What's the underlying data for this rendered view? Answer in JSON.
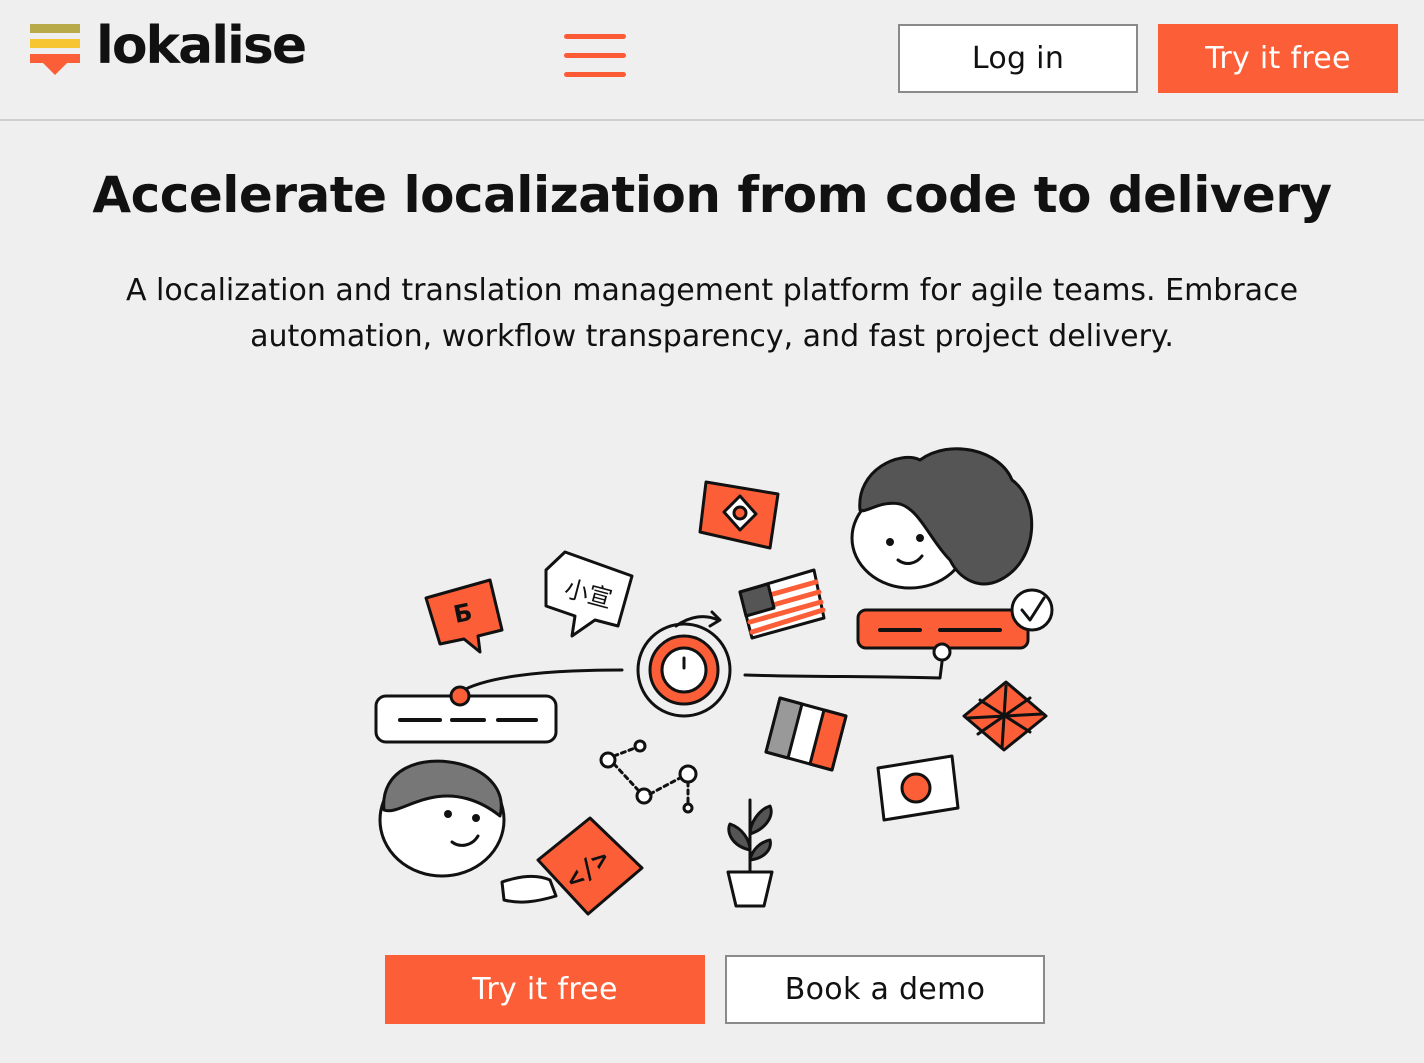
{
  "header": {
    "logo_text": "lokalise",
    "menu_icon": "hamburger-menu-icon",
    "login_label": "Log in",
    "try_free_label": "Try it free"
  },
  "hero": {
    "title": "Accelerate localization from code to delivery",
    "subtitle_line1": "A localization and translation management platform for agile teams. Embrace",
    "subtitle_line2": "automation, workflow transparency, and fast project delivery."
  },
  "illustration": {
    "cyrillic_glyph": "Б",
    "chinese_glyph": "小宣",
    "code_glyph": "</>",
    "icons": [
      "speech-bubble-icon",
      "clock-icon",
      "flag-icon",
      "person-icon",
      "plant-icon",
      "graph-icon",
      "checkmark-icon"
    ]
  },
  "cta": {
    "try_free_label": "Try it free",
    "book_demo_label": "Book a demo"
  },
  "colors": {
    "accent": "#fc5f38",
    "logo_olive": "#b8aa48",
    "logo_yellow": "#f6c531",
    "background": "#efefef",
    "text": "#111111"
  }
}
